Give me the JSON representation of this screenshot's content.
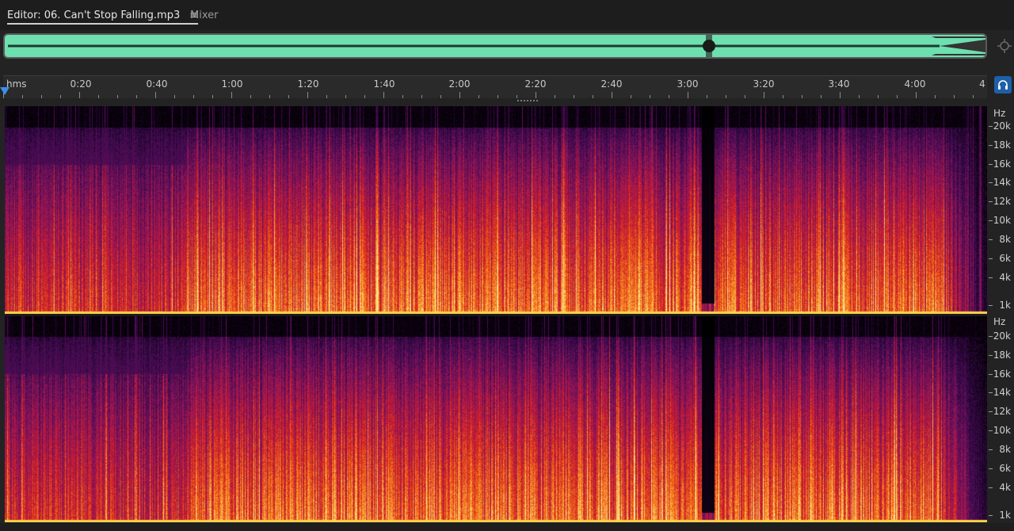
{
  "tabs": {
    "editor_label": "Editor: 06. Can't Stop Falling.mp3",
    "menu_glyph": "≡",
    "mixer_label": "Mixer"
  },
  "ruler": {
    "unit": "hms",
    "ticks": [
      "0:20",
      "0:40",
      "1:00",
      "1:20",
      "1:40",
      "2:00",
      "2:20",
      "2:40",
      "3:00",
      "3:20",
      "3:40",
      "4:00",
      "4"
    ]
  },
  "channels": [
    {
      "hz_unit": "Hz",
      "hz_labels": [
        "20k",
        "18k",
        "16k",
        "14k",
        "12k",
        "10k",
        "8k",
        "6k",
        "4k",
        "1k"
      ]
    },
    {
      "hz_unit": "Hz",
      "hz_labels": [
        "20k",
        "18k",
        "16k",
        "14k",
        "12k",
        "10k",
        "8k",
        "6k",
        "4k",
        "1k"
      ]
    }
  ],
  "icons": {
    "zoom": "zoom-navigator-icon",
    "monitor": "headphones-icon",
    "playhead": "playhead-marker-icon"
  },
  "colors": {
    "waveform": "#6ee0b0",
    "playhead": "#3b8ee8",
    "monitor_button": "#1f5fa8"
  }
}
